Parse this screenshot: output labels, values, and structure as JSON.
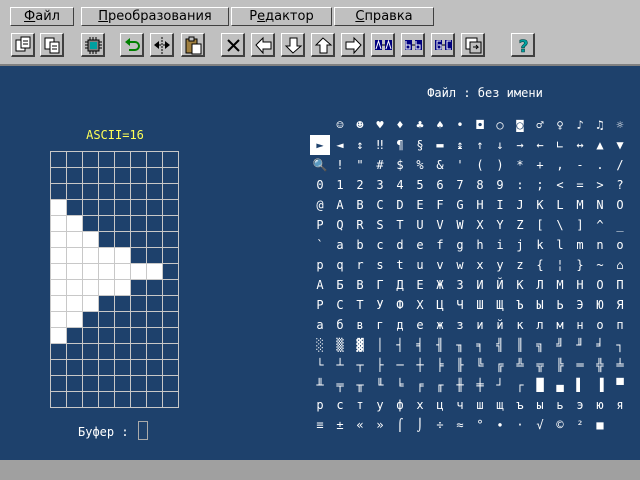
{
  "menu": {
    "items": [
      {
        "label": "Файл",
        "accel": "Ф"
      },
      {
        "label": "Преобразования",
        "accel": "П"
      },
      {
        "label": "Редактор",
        "accel": "е"
      },
      {
        "label": "Справка",
        "accel": "С"
      }
    ]
  },
  "toolbar": {
    "buttons": [
      {
        "icon": "open-file-icon"
      },
      {
        "icon": "save-file-icon"
      },
      {
        "icon": "chip-icon"
      },
      {
        "icon": "undo-icon"
      },
      {
        "icon": "mirror-horizontal-icon"
      },
      {
        "icon": "clipboard-paste-icon"
      },
      {
        "icon": "clear-icon"
      },
      {
        "icon": "shift-left-icon"
      },
      {
        "icon": "shift-down-icon"
      },
      {
        "icon": "shift-up-icon"
      },
      {
        "icon": "shift-right-icon"
      },
      {
        "icon": "font-op-1-icon"
      },
      {
        "icon": "font-op-2-icon"
      },
      {
        "icon": "font-op-3-icon"
      },
      {
        "icon": "font-op-4-icon"
      },
      {
        "icon": "help-icon"
      }
    ]
  },
  "charmap": {
    "title": "Файл : без имени",
    "selected_index": 16,
    "chars": [
      " ",
      "☺",
      "☻",
      "♥",
      "♦",
      "♣",
      "♠",
      "•",
      "◘",
      "○",
      "◙",
      "♂",
      "♀",
      "♪",
      "♫",
      "☼",
      "►",
      "◄",
      "↕",
      "‼",
      "¶",
      "§",
      "▬",
      "↨",
      "↑",
      "↓",
      "→",
      "←",
      "∟",
      "↔",
      "▲",
      "▼",
      "🔍",
      "!",
      "\"",
      "#",
      "$",
      "%",
      "&",
      "'",
      "(",
      ")",
      "*",
      "+",
      ",",
      "-",
      ".",
      "/",
      "0",
      "1",
      "2",
      "3",
      "4",
      "5",
      "6",
      "7",
      "8",
      "9",
      ":",
      ";",
      "<",
      "=",
      ">",
      "?",
      "@",
      "A",
      "B",
      "C",
      "D",
      "E",
      "F",
      "G",
      "H",
      "I",
      "J",
      "K",
      "L",
      "M",
      "N",
      "O",
      "P",
      "Q",
      "R",
      "S",
      "T",
      "U",
      "V",
      "W",
      "X",
      "Y",
      "Z",
      "[",
      "\\",
      "]",
      "^",
      "_",
      "`",
      "a",
      "b",
      "c",
      "d",
      "e",
      "f",
      "g",
      "h",
      "i",
      "j",
      "k",
      "l",
      "m",
      "n",
      "o",
      "p",
      "q",
      "r",
      "s",
      "t",
      "u",
      "v",
      "w",
      "x",
      "y",
      "z",
      "{",
      "¦",
      "}",
      "~",
      "⌂",
      "А",
      "Б",
      "В",
      "Г",
      "Д",
      "Е",
      "Ж",
      "З",
      "И",
      "Й",
      "К",
      "Л",
      "М",
      "Н",
      "О",
      "П",
      "Р",
      "С",
      "Т",
      "У",
      "Ф",
      "Х",
      "Ц",
      "Ч",
      "Ш",
      "Щ",
      "Ъ",
      "Ы",
      "Ь",
      "Э",
      "Ю",
      "Я",
      "а",
      "б",
      "в",
      "г",
      "д",
      "е",
      "ж",
      "з",
      "и",
      "й",
      "к",
      "л",
      "м",
      "н",
      "о",
      "п",
      "░",
      "▒",
      "▓",
      "│",
      "┤",
      "╡",
      "╢",
      "╖",
      "╕",
      "╣",
      "║",
      "╗",
      "╝",
      "╜",
      "╛",
      "┐",
      "└",
      "┴",
      "┬",
      "├",
      "─",
      "┼",
      "╞",
      "╟",
      "╚",
      "╔",
      "╩",
      "╦",
      "╠",
      "═",
      "╬",
      "╧",
      "╨",
      "╤",
      "╥",
      "╙",
      "╘",
      "╒",
      "╓",
      "╫",
      "╪",
      "┘",
      "┌",
      "█",
      "▄",
      "▌",
      "▐",
      "▀",
      "р",
      "с",
      "т",
      "у",
      "ф",
      "х",
      "ц",
      "ч",
      "ш",
      "щ",
      "ъ",
      "ы",
      "ь",
      "э",
      "ю",
      "я",
      "≡",
      "±",
      "«",
      "»",
      "⌠",
      "⌡",
      "÷",
      "≈",
      "°",
      "∙",
      "·",
      "√",
      "©",
      "²",
      "■",
      " "
    ]
  },
  "editor": {
    "ascii_label": "ASCII=16",
    "grid_cols": 8,
    "grid_rows": 16,
    "bitmap": [
      "00000000",
      "00000000",
      "00000000",
      "10000000",
      "11000000",
      "11100000",
      "11111000",
      "11111110",
      "11111000",
      "11100000",
      "11000000",
      "10000000",
      "00000000",
      "00000000",
      "00000000",
      "00000000"
    ]
  },
  "buffer": {
    "label": "Буфер :"
  },
  "colors": {
    "background": "#1e416c",
    "panel": "#c0c0c0",
    "ascii_label": "#ffff55",
    "grid_line": "#c8c8c8"
  }
}
